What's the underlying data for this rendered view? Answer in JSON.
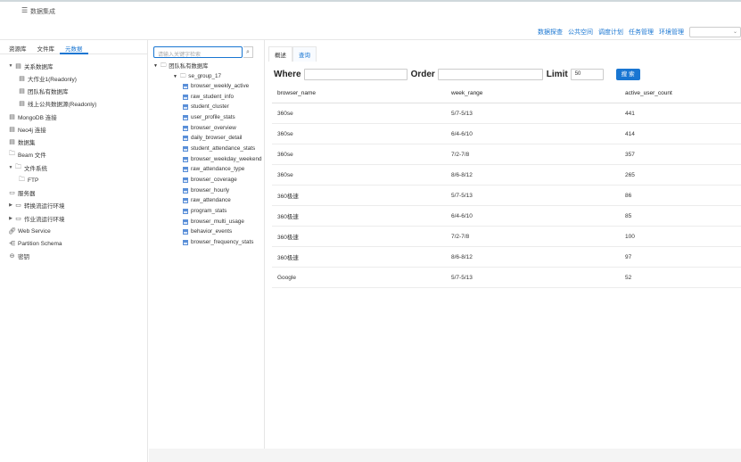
{
  "header": {
    "title": "数据集成"
  },
  "nav": {
    "items": [
      "数据探查",
      "公共空间",
      "调度计划",
      "任务管理",
      "环境管理"
    ],
    "select_value": ""
  },
  "left": {
    "tabs": [
      "资源库",
      "文件库",
      "元数据"
    ],
    "active_tab": 2,
    "tree": [
      "关系数据库",
      "大作业1(Readonly)",
      "团队私有数据库",
      "线上公共数据源(Readonly)",
      "MongoDB 连接",
      "Neo4j 连接",
      "数据集",
      "Beam 文件",
      "文件系统",
      "FTP",
      "服务器",
      "转换流运行环境",
      "作业流运行环境",
      "Web Service",
      "Partition Schema",
      "密钥"
    ]
  },
  "middle": {
    "search_placeholder": "请输入关键字检索",
    "root": "团队私有数据库",
    "group": "se_group_17",
    "tables": [
      "browser_weekly_active",
      "raw_student_info",
      "student_cluster",
      "user_profile_stats",
      "browser_overview",
      "daily_browser_detail",
      "student_attendance_stats",
      "browser_weekday_weekend",
      "raw_attendance_type",
      "browser_coverage",
      "browser_hourly",
      "raw_attendance",
      "program_stats",
      "browser_multi_usage",
      "behavior_events",
      "browser_frequency_stats"
    ]
  },
  "right": {
    "tabs": [
      "概述",
      "查询"
    ],
    "active_tab": 1,
    "where_label": "Where",
    "order_label": "Order",
    "limit_label": "Limit",
    "where_value": "",
    "order_value": "",
    "limit_value": "50",
    "search_button": "搜 索",
    "columns": [
      "browser_name",
      "week_range",
      "active_user_count"
    ],
    "rows": [
      [
        "360se",
        "5/7-5/13",
        "441"
      ],
      [
        "360se",
        "6/4-6/10",
        "414"
      ],
      [
        "360se",
        "7/2-7/8",
        "357"
      ],
      [
        "360se",
        "8/6-8/12",
        "265"
      ],
      [
        "360极速",
        "5/7-5/13",
        "86"
      ],
      [
        "360极速",
        "6/4-6/10",
        "85"
      ],
      [
        "360极速",
        "7/2-7/8",
        "100"
      ],
      [
        "360极速",
        "8/6-8/12",
        "97"
      ],
      [
        "Google",
        "5/7-5/13",
        "52"
      ]
    ]
  }
}
